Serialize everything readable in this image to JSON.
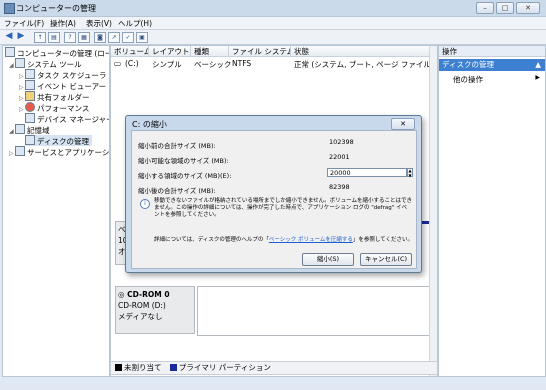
{
  "window": {
    "title": "コンピューターの管理",
    "controls": [
      "–",
      "□",
      "✕"
    ]
  },
  "menu": {
    "items": [
      "ファイル(F)",
      "操作(A)",
      "表示(V)",
      "ヘルプ(H)"
    ]
  },
  "toolbar": {
    "buttons": [
      "back-icon",
      "forward-icon",
      "up-folder-icon",
      "show-hide-tree-icon",
      "help-icon",
      "properties-icon",
      "disk-icon",
      "export-icon",
      "check-icon",
      "refresh-icon"
    ]
  },
  "tree": {
    "items": [
      {
        "label": "コンピューターの管理 (ローカ",
        "indent": 0,
        "expander": "",
        "icon": "computer-icon"
      },
      {
        "label": "システム ツール",
        "indent": 1,
        "expander": "◢",
        "icon": "tools-icon"
      },
      {
        "label": "タスク スケジューラ",
        "indent": 2,
        "expander": "▷",
        "icon": "clock-icon"
      },
      {
        "label": "イベント ビューアー",
        "indent": 2,
        "expander": "▷",
        "icon": "event-viewer-icon"
      },
      {
        "label": "共有フォルダー",
        "indent": 2,
        "expander": "▷",
        "icon": "shared-folder-icon"
      },
      {
        "label": "パフォーマンス",
        "indent": 2,
        "expander": "▷",
        "icon": "performance-icon"
      },
      {
        "label": "デバイス マネージャー",
        "indent": 2,
        "expander": "",
        "icon": "device-manager-icon"
      },
      {
        "label": "記憶域",
        "indent": 1,
        "expander": "◢",
        "icon": "storage-icon"
      },
      {
        "label": "ディスクの管理",
        "indent": 2,
        "expander": "",
        "icon": "disk-management-icon"
      },
      {
        "label": "サービスとアプリケーション",
        "indent": 1,
        "expander": "▷",
        "icon": "services-icon"
      }
    ]
  },
  "volume_table": {
    "headers": [
      "ボリューム",
      "レイアウト",
      "種類",
      "ファイル システム",
      "状態"
    ],
    "rows": [
      {
        "volume": "(C:)",
        "layout": "シンプル",
        "type": "ベーシック",
        "fs": "NTFS",
        "status": "正常 (システム, ブート, ページ ファイル, アクテ"
      }
    ]
  },
  "disk0": {
    "lines": [
      "ベー",
      "10",
      "オン"
    ]
  },
  "cdrom": {
    "name": "CD-ROM 0",
    "drive": "CD-ROM (D:)",
    "media": "メディアなし"
  },
  "legend": {
    "unallocated": "未割り当て",
    "primary": "プライマリ パーティション",
    "colors": {
      "unallocated": "#000000",
      "primary": "#1a2a9c"
    }
  },
  "actions": {
    "header": "操作",
    "selected": "ディスクの管理",
    "item": "他の操作"
  },
  "dialog": {
    "title": "C: の縮小",
    "close": "✕",
    "fields": [
      {
        "label": "縮小前の合計サイズ (MB):",
        "value": "102398"
      },
      {
        "label": "縮小可能な領域のサイズ (MB):",
        "value": "22001"
      },
      {
        "label": "縮小する領域のサイズ (MB)(E):",
        "value": "20000"
      },
      {
        "label": "縮小後の合計サイズ (MB):",
        "value": "82398"
      }
    ],
    "info": "移動できないファイルが格納されている場所までしか縮小できません。ボリュームを縮小することはできません。この操作の詳細については、操作が完了した時点で、アプリケーション ログの \"defrag\" イベントを参照してください。",
    "detail_prefix": "詳細については、ディスクの管理のヘルプの「",
    "detail_link": "ベーシック ボリュームを圧縮する",
    "detail_suffix": "」を参照してください。",
    "shrink_button": "縮小(S)",
    "cancel_button": "キャンセル(C)"
  }
}
